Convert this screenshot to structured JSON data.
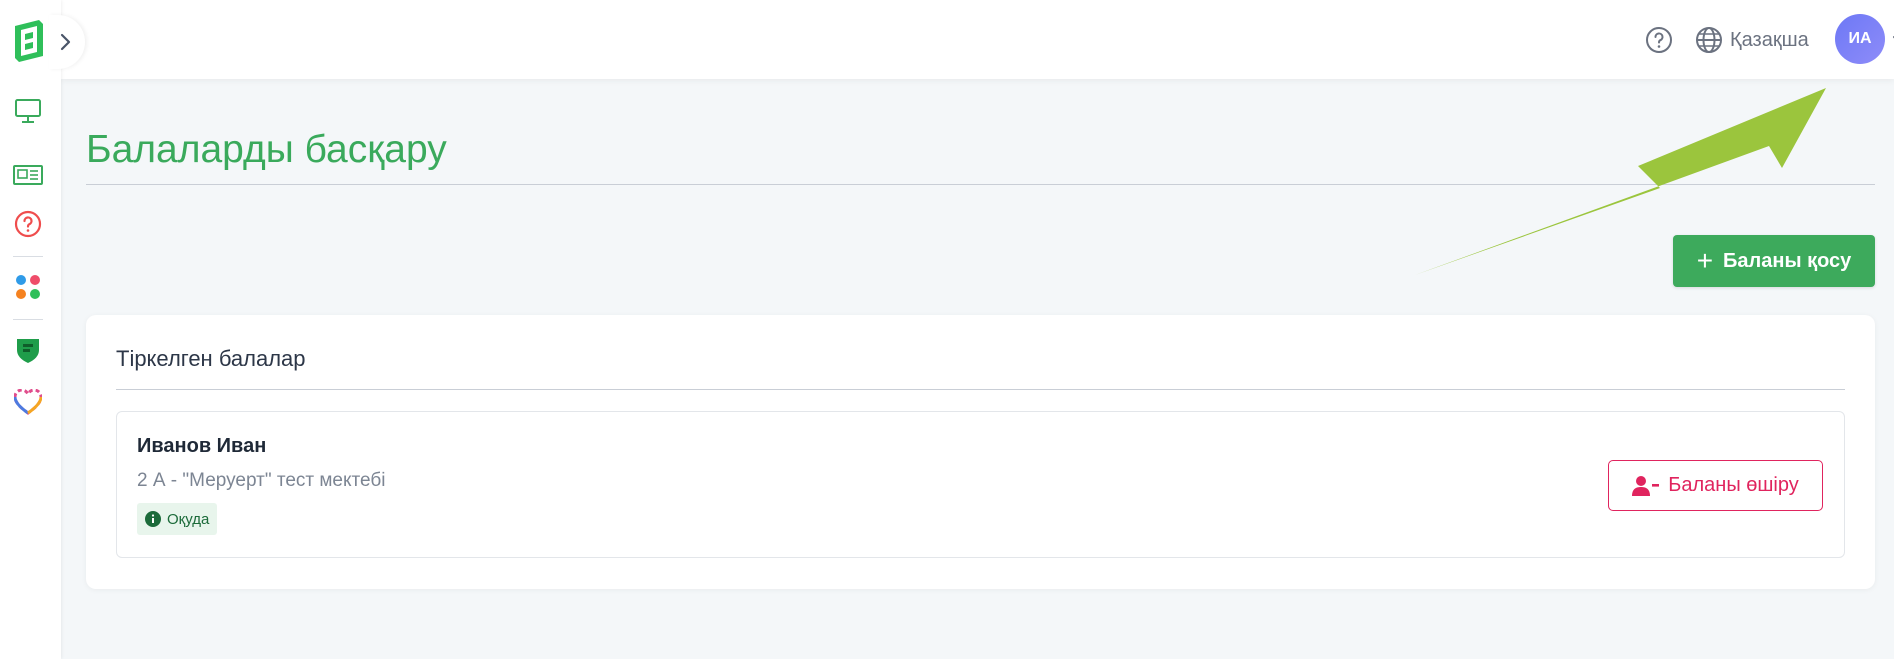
{
  "header": {
    "language_label": "Қазақша",
    "avatar_initials": "ИА"
  },
  "page": {
    "title": "Балаларды басқару",
    "add_button_label": "Баланы қосу"
  },
  "card": {
    "title": "Тіркелген балалар",
    "children": [
      {
        "name": "Иванов Иван",
        "school": "2 А - \"Меруерт\" тест мектебі",
        "status": "Оқуда",
        "delete_label": "Баланы өшіру"
      }
    ]
  },
  "colors": {
    "brand_green": "#3aaa5c",
    "danger": "#e0245e",
    "avatar": "#7b7ff7",
    "annotation_arrow": "#9bc53d"
  }
}
